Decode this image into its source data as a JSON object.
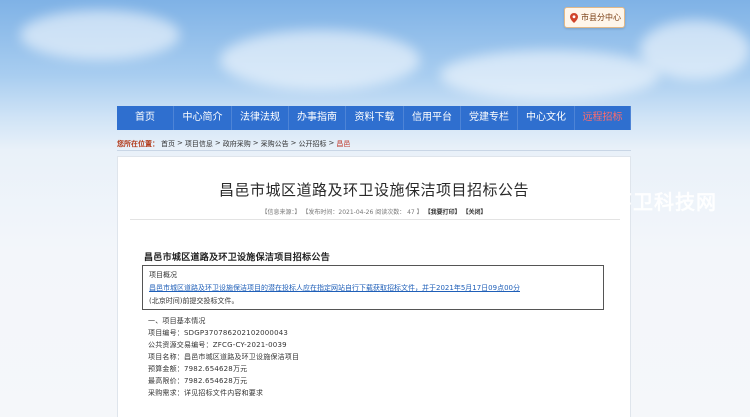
{
  "region_button": {
    "label": "市县分中心"
  },
  "nav": {
    "items": [
      {
        "label": "首页"
      },
      {
        "label": "中心简介"
      },
      {
        "label": "法律法规"
      },
      {
        "label": "办事指南"
      },
      {
        "label": "资料下载"
      },
      {
        "label": "信用平台"
      },
      {
        "label": "党建专栏"
      },
      {
        "label": "中心文化"
      },
      {
        "label": "远程招标"
      }
    ],
    "bg_color": "#2f6fcf",
    "special_color": "#ff6b6b"
  },
  "breadcrumb": {
    "label": "您所在位置：",
    "items": [
      "首页",
      "项目信息",
      "政府采购",
      "采购公告",
      "公开招标",
      "昌邑"
    ]
  },
  "article": {
    "title": "昌邑市城区道路及环卫设施保洁项目招标公告",
    "meta_source": "【信息来源：】",
    "meta_time": "【发布时间：2021-04-26",
    "meta_views": "阅读次数：  47 】",
    "meta_print": "【我要打印】",
    "meta_close": "【关闭】",
    "doc_heading": "昌邑市城区道路及环卫设施保洁项目招标公告",
    "box_lines": [
      "项目概况",
      "昌邑市城区道路及环卫设施保洁项目的潜在投标人应在指定网站自行下载获取招标文件，并于2021年5月17日09点00分",
      "(北京时间)前提交投标文件。"
    ],
    "lines": [
      "一、项目基本情况",
      "项目编号：SDGP370786202102000043",
      "公共资源交易编号：ZFCG-CY-2021-0039",
      "项目名称：昌邑市城区道路及环卫设施保洁项目",
      "预算金额：7982.654628万元",
      "最高限价：7982.654628万元",
      "采购需求：详见招标文件内容和要求"
    ]
  },
  "watermark": {
    "text": "环卫科技网"
  }
}
